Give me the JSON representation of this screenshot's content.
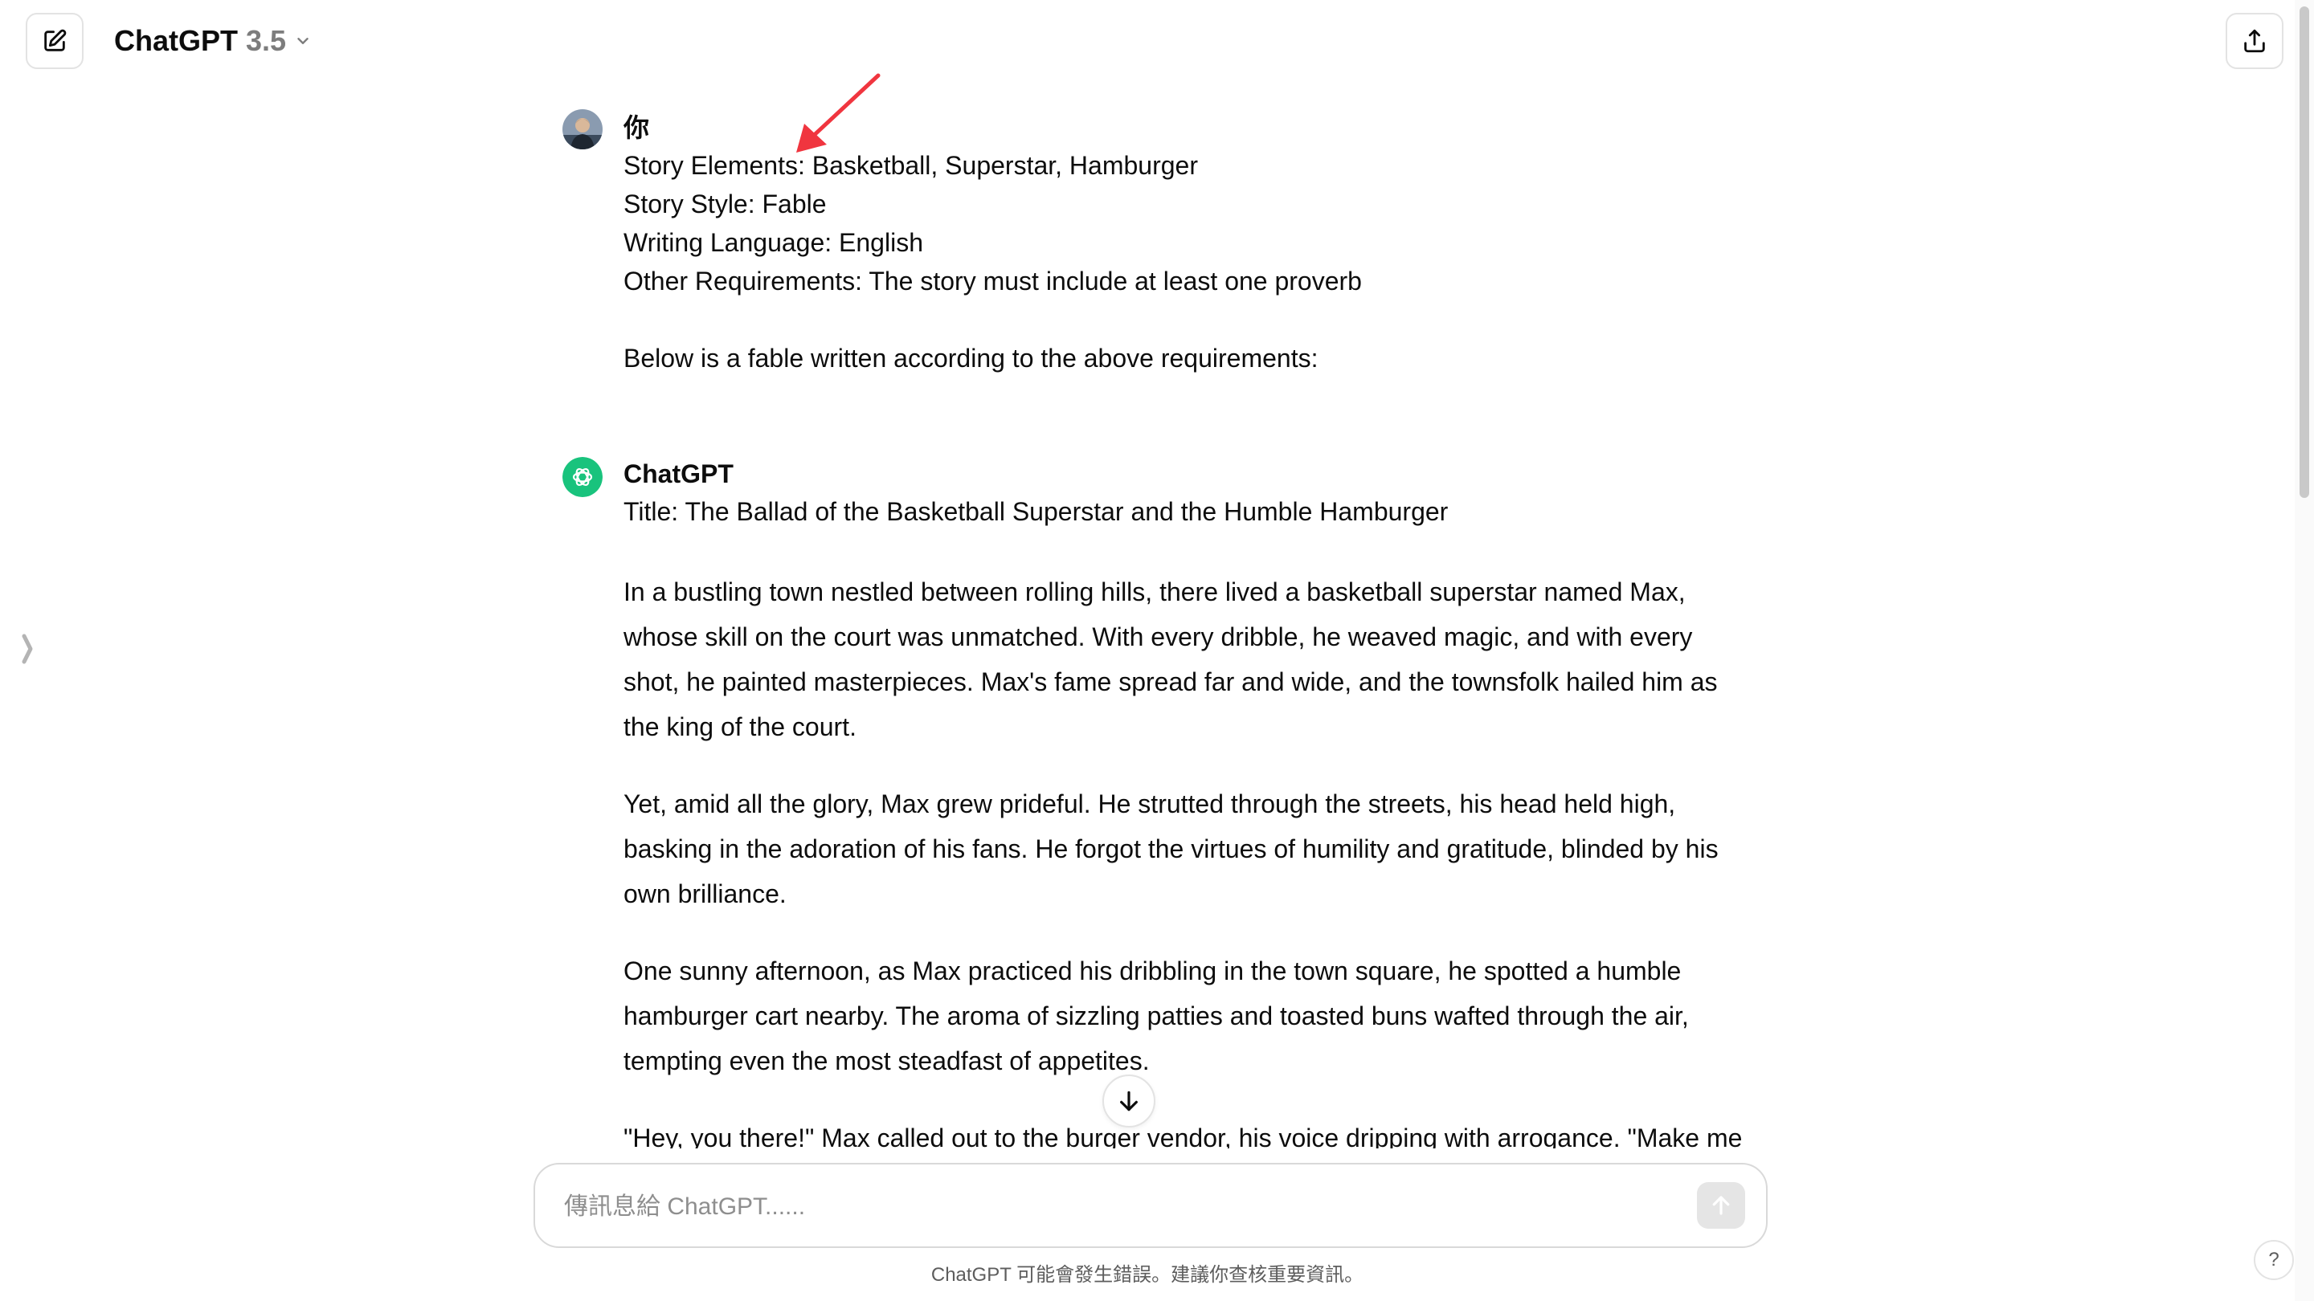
{
  "header": {
    "model_name": "ChatGPT",
    "model_version": "3.5",
    "new_chat_icon": "pencil-square-icon",
    "share_icon": "share-upload-icon",
    "dropdown_icon": "chevron-down-icon"
  },
  "conversation": {
    "user_message": {
      "author": "你",
      "lines": [
        "Story Elements: Basketball, Superstar, Hamburger",
        "Story Style: Fable",
        "Writing Language: English",
        "Other Requirements: The story must include at least one proverb",
        "Below is a fable written according to the above requirements:"
      ]
    },
    "assistant_message": {
      "author": "ChatGPT",
      "title": "Title: The Ballad of the Basketball Superstar and the Humble Hamburger",
      "paragraphs": [
        "In a bustling town nestled between rolling hills, there lived a basketball superstar named Max, whose skill on the court was unmatched. With every dribble, he weaved magic, and with every shot, he painted masterpieces. Max's fame spread far and wide, and the townsfolk hailed him as the king of the court.",
        "Yet, amid all the glory, Max grew prideful. He strutted through the streets, his head held high, basking in the adoration of his fans. He forgot the virtues of humility and gratitude, blinded by his own brilliance.",
        "One sunny afternoon, as Max practiced his dribbling in the town square, he spotted a humble hamburger cart nearby. The aroma of sizzling patties and toasted buns wafted through the air, tempting even the most steadfast of appetites.",
        "\"Hey, you there!\" Max called out to the burger vendor, his voice dripping with arrogance. \"Make me"
      ]
    }
  },
  "composer": {
    "placeholder": "傳訊息給 ChatGPT......",
    "send_icon": "arrow-up-icon"
  },
  "disclaimer": "ChatGPT 可能會發生錯誤。建議你查核重要資訊。",
  "help_label": "?",
  "colors": {
    "accent_green": "#19c37d",
    "annotation_red": "#f0353f"
  }
}
